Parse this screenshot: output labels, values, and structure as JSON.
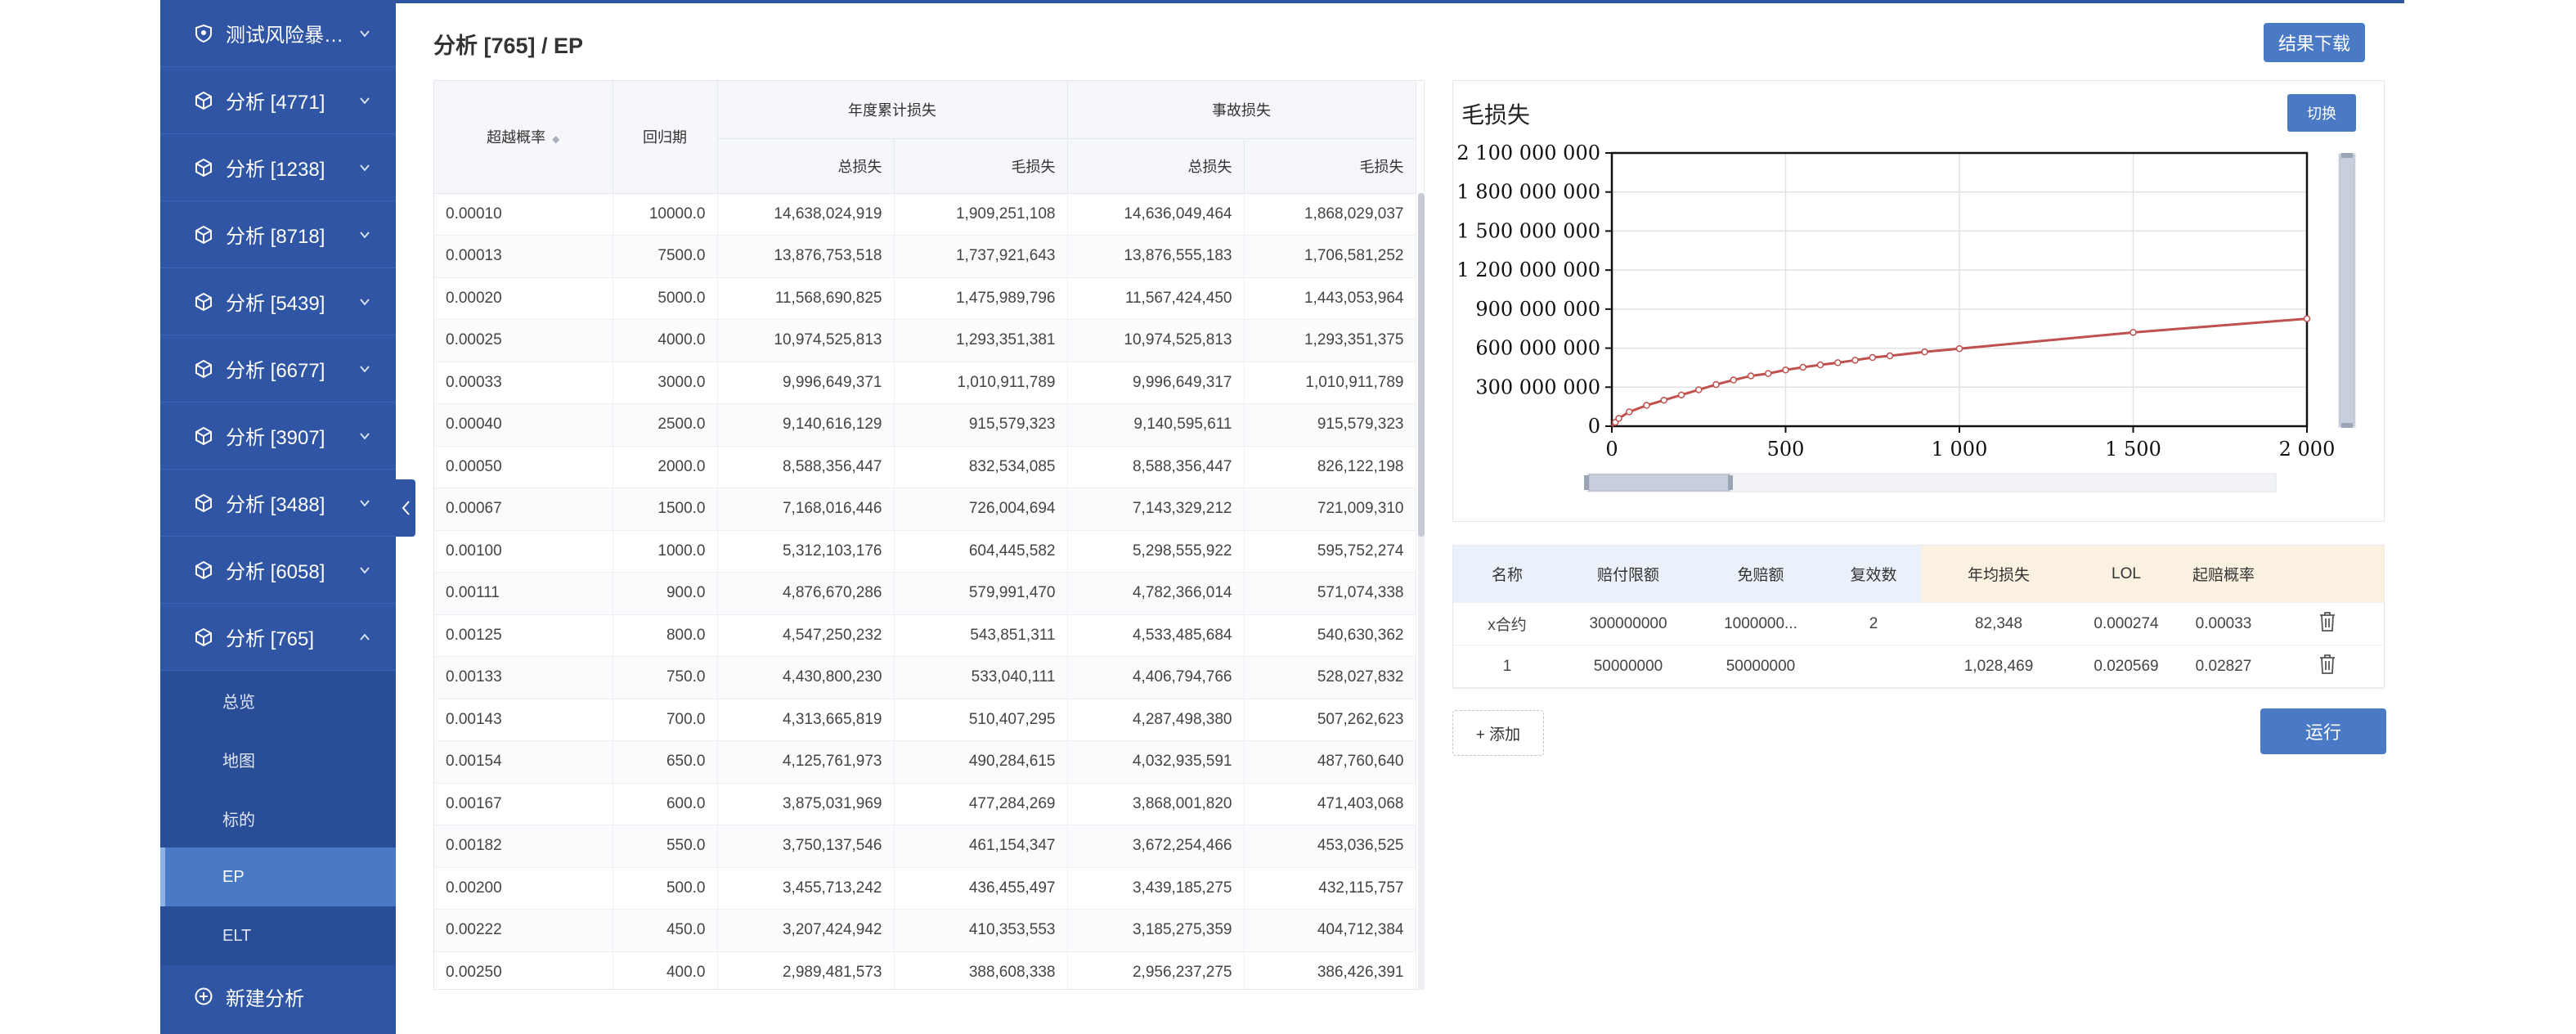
{
  "sidebar": {
    "items": [
      {
        "label": "测试风险暴露..."
      },
      {
        "label": "分析 [4771]"
      },
      {
        "label": "分析 [1238]"
      },
      {
        "label": "分析 [8718]"
      },
      {
        "label": "分析 [5439]"
      },
      {
        "label": "分析 [6677]"
      },
      {
        "label": "分析 [3907]"
      },
      {
        "label": "分析 [3488]"
      },
      {
        "label": "分析 [6058]"
      },
      {
        "label": "分析 [765]",
        "expanded": true
      }
    ],
    "submenu": [
      {
        "label": "总览"
      },
      {
        "label": "地图"
      },
      {
        "label": "标的"
      },
      {
        "label": "EP",
        "active": true
      },
      {
        "label": "ELT"
      }
    ],
    "new_analysis": "新建分析"
  },
  "header": {
    "title": "分析 [765] / EP",
    "download_label": "结果下载"
  },
  "ep_table": {
    "headers": {
      "exceed_prob": "超越概率",
      "return_period": "回归期",
      "annual_group": "年度累计损失",
      "event_group": "事故损失",
      "total_loss": "总损失",
      "gross_loss": "毛损失"
    },
    "rows": [
      [
        "0.00010",
        "10000.0",
        "14,638,024,919",
        "1,909,251,108",
        "14,636,049,464",
        "1,868,029,037"
      ],
      [
        "0.00013",
        "7500.0",
        "13,876,753,518",
        "1,737,921,643",
        "13,876,555,183",
        "1,706,581,252"
      ],
      [
        "0.00020",
        "5000.0",
        "11,568,690,825",
        "1,475,989,796",
        "11,567,424,450",
        "1,443,053,964"
      ],
      [
        "0.00025",
        "4000.0",
        "10,974,525,813",
        "1,293,351,381",
        "10,974,525,813",
        "1,293,351,375"
      ],
      [
        "0.00033",
        "3000.0",
        "9,996,649,371",
        "1,010,911,789",
        "9,996,649,317",
        "1,010,911,789"
      ],
      [
        "0.00040",
        "2500.0",
        "9,140,616,129",
        "915,579,323",
        "9,140,595,611",
        "915,579,323"
      ],
      [
        "0.00050",
        "2000.0",
        "8,588,356,447",
        "832,534,085",
        "8,588,356,447",
        "826,122,198"
      ],
      [
        "0.00067",
        "1500.0",
        "7,168,016,446",
        "726,004,694",
        "7,143,329,212",
        "721,009,310"
      ],
      [
        "0.00100",
        "1000.0",
        "5,312,103,176",
        "604,445,582",
        "5,298,555,922",
        "595,752,274"
      ],
      [
        "0.00111",
        "900.0",
        "4,876,670,286",
        "579,991,470",
        "4,782,366,014",
        "571,074,338"
      ],
      [
        "0.00125",
        "800.0",
        "4,547,250,232",
        "543,851,311",
        "4,533,485,684",
        "540,630,362"
      ],
      [
        "0.00133",
        "750.0",
        "4,430,800,230",
        "533,040,111",
        "4,406,794,766",
        "528,027,832"
      ],
      [
        "0.00143",
        "700.0",
        "4,313,665,819",
        "510,407,295",
        "4,287,498,380",
        "507,262,623"
      ],
      [
        "0.00154",
        "650.0",
        "4,125,761,973",
        "490,284,615",
        "4,032,935,591",
        "487,760,640"
      ],
      [
        "0.00167",
        "600.0",
        "3,875,031,969",
        "477,284,269",
        "3,868,001,820",
        "471,403,068"
      ],
      [
        "0.00182",
        "550.0",
        "3,750,137,546",
        "461,154,347",
        "3,672,254,466",
        "453,036,525"
      ],
      [
        "0.00200",
        "500.0",
        "3,455,713,242",
        "436,455,497",
        "3,439,185,275",
        "432,115,757"
      ],
      [
        "0.00222",
        "450.0",
        "3,207,424,942",
        "410,353,553",
        "3,185,275,359",
        "404,712,384"
      ],
      [
        "0.00250",
        "400.0",
        "2,989,481,573",
        "388,608,338",
        "2,956,237,275",
        "386,426,391"
      ]
    ]
  },
  "chart_panel": {
    "switch_label": "切换"
  },
  "chart_data": {
    "type": "line",
    "title": "毛损失",
    "xlabel": "",
    "ylabel": "",
    "xlim": [
      0,
      2000
    ],
    "ylim": [
      0,
      2100000000
    ],
    "x_ticks": [
      "0",
      "500",
      "1 000",
      "1 500",
      "2 000"
    ],
    "y_ticks": [
      "0",
      "300 000 000",
      "600 000 000",
      "900 000 000",
      "1 200 000 000",
      "1 500 000 000",
      "1 800 000 000",
      "2 100 000 000"
    ],
    "grid": true,
    "series_color": "#c0504d",
    "series": [
      {
        "x": [
          0,
          10,
          20,
          50,
          100,
          150,
          200,
          250,
          300,
          350,
          400,
          450,
          500,
          550,
          600,
          650,
          700,
          750,
          800,
          900,
          1000,
          1500,
          2000
        ],
        "values": [
          0,
          30000000,
          60000000,
          110000000,
          160000000,
          200000000,
          240000000,
          280000000,
          320000000,
          355000000,
          386426391,
          404712384,
          432115757,
          453036525,
          471403068,
          487760640,
          507262623,
          528027832,
          540630362,
          571074338,
          595752274,
          721009310,
          826122198
        ]
      }
    ]
  },
  "contracts": {
    "headers": [
      "名称",
      "赔付限额",
      "免赔额",
      "复效数",
      "年均损失",
      "LOL",
      "起赔概率"
    ],
    "rows": [
      [
        "x合约",
        "300000000",
        "1000000...",
        "2",
        "82,348",
        "0.000274",
        "0.00033"
      ],
      [
        "1",
        "50000000",
        "50000000",
        "",
        "1,028,469",
        "0.020569",
        "0.02827"
      ]
    ],
    "add_label": "+ 添加",
    "run_label": "运行"
  },
  "colors": {
    "sidebar": "#2f55a4",
    "accent": "#4a7ac5",
    "line": "#c0504d"
  }
}
